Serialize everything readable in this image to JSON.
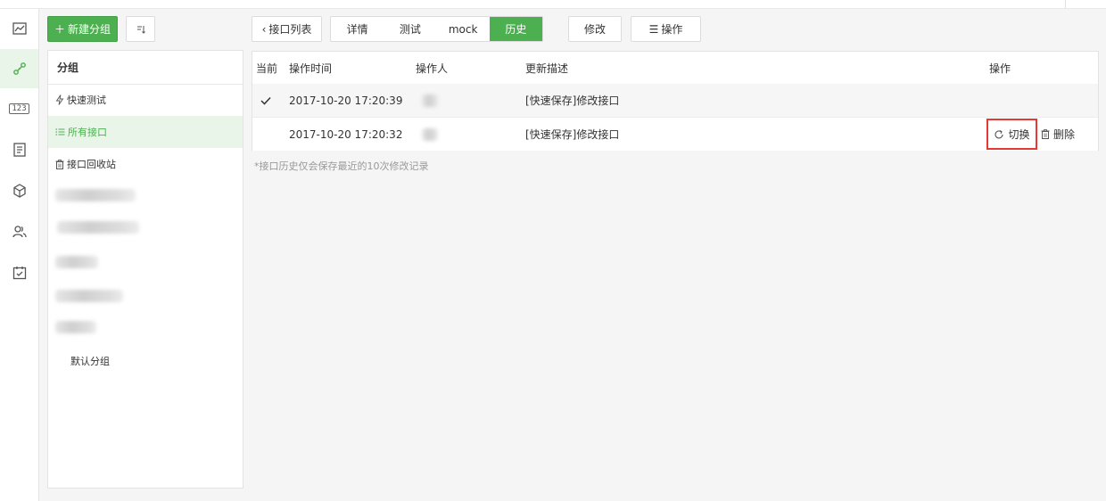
{
  "toolbar": {
    "new_group_label": "新建分组",
    "back_label": "接口列表",
    "tabs": [
      {
        "label": "详情",
        "active": false
      },
      {
        "label": "测试",
        "active": false
      },
      {
        "label": "mock",
        "active": false
      },
      {
        "label": "历史",
        "active": true
      }
    ],
    "edit_label": "修改",
    "actions_label": "操作"
  },
  "sidebar": {
    "header": "分组",
    "items": [
      {
        "label": "快速测试",
        "icon": "lightning-icon",
        "active": false
      },
      {
        "label": "所有接口",
        "icon": "list-icon",
        "active": true
      },
      {
        "label": "接口回收站",
        "icon": "trash-icon",
        "active": false
      }
    ],
    "default_group": "默认分组"
  },
  "history": {
    "columns": [
      "当前",
      "操作时间",
      "操作人",
      "更新描述",
      "操作"
    ],
    "rows": [
      {
        "current": true,
        "time": "2017-10-20 17:20:39",
        "desc": "[快速保存]修改接口"
      },
      {
        "current": false,
        "time": "2017-10-20 17:20:32",
        "desc": "[快速保存]修改接口"
      }
    ],
    "switch_label": "切换",
    "delete_label": "删除",
    "note": "*接口历史仅会保存最近的10次修改记录"
  },
  "colors": {
    "accent": "#4caf50",
    "highlight": "#e53935"
  }
}
